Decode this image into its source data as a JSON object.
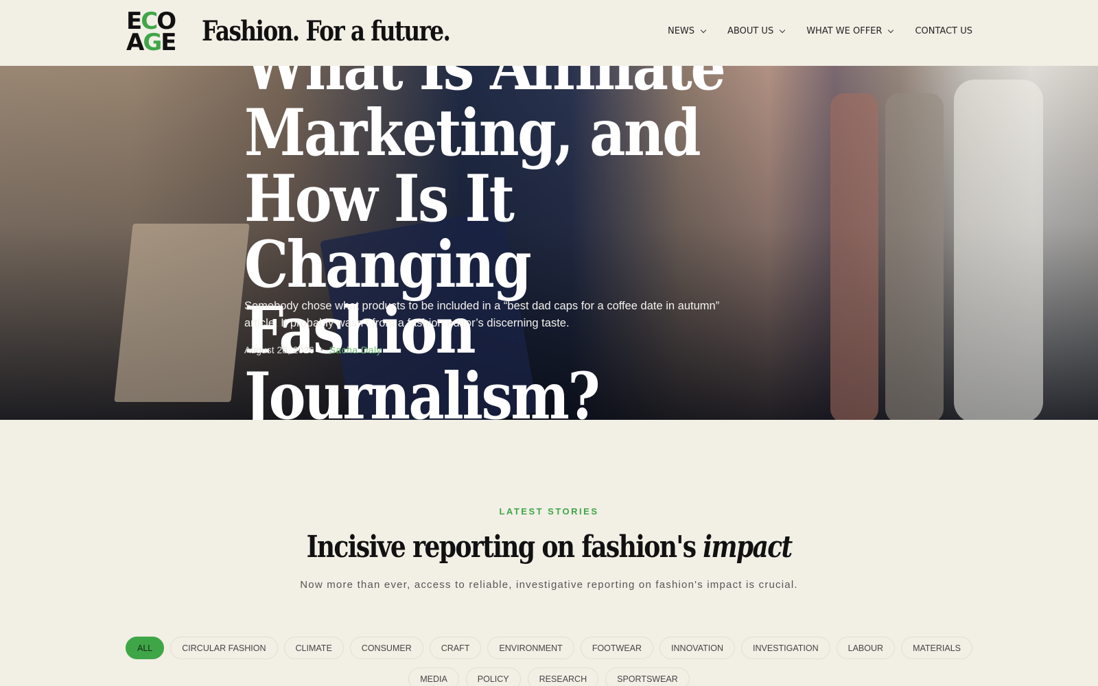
{
  "brand": {
    "logo_row1": [
      "E",
      "C",
      "O"
    ],
    "logo_row2": [
      "A",
      "G",
      "E"
    ],
    "tagline": "Fashion. For a future.",
    "accent_color": "#3fa648"
  },
  "nav": {
    "items": [
      {
        "label": "NEWS",
        "has_dropdown": true
      },
      {
        "label": "ABOUT US",
        "has_dropdown": true
      },
      {
        "label": "WHAT WE OFFER",
        "has_dropdown": true
      },
      {
        "label": "CONTACT US",
        "has_dropdown": false
      }
    ]
  },
  "hero": {
    "title": "What Is Affiliate Marketing, and How Is It Changing Fashion Journalism?",
    "excerpt": "Somebody chose what products to be included in a “best dad caps for a coffee date in autumn” article. It probably wasn’t from a fashion editor’s discerning taste.",
    "date": "August 28, 2026",
    "separator": "•",
    "author": "Sacha Daly"
  },
  "latest": {
    "eyebrow": "LATEST STORIES",
    "title_main": "Incisive reporting on fashion's ",
    "title_emphasis": "impact",
    "subtitle": "Now more than ever, access to reliable, investigative reporting on fashion's impact is crucial."
  },
  "filters": {
    "row1": [
      "ALL",
      "CIRCULAR FASHION",
      "CLIMATE",
      "CONSUMER",
      "CRAFT",
      "ENVIRONMENT",
      "FOOTWEAR",
      "INNOVATION",
      "INVESTIGATION",
      "LABOUR",
      "MATERIALS"
    ],
    "row2": [
      "MEDIA",
      "POLICY",
      "RESEARCH",
      "SPORTSWEAR"
    ],
    "active": "ALL"
  }
}
